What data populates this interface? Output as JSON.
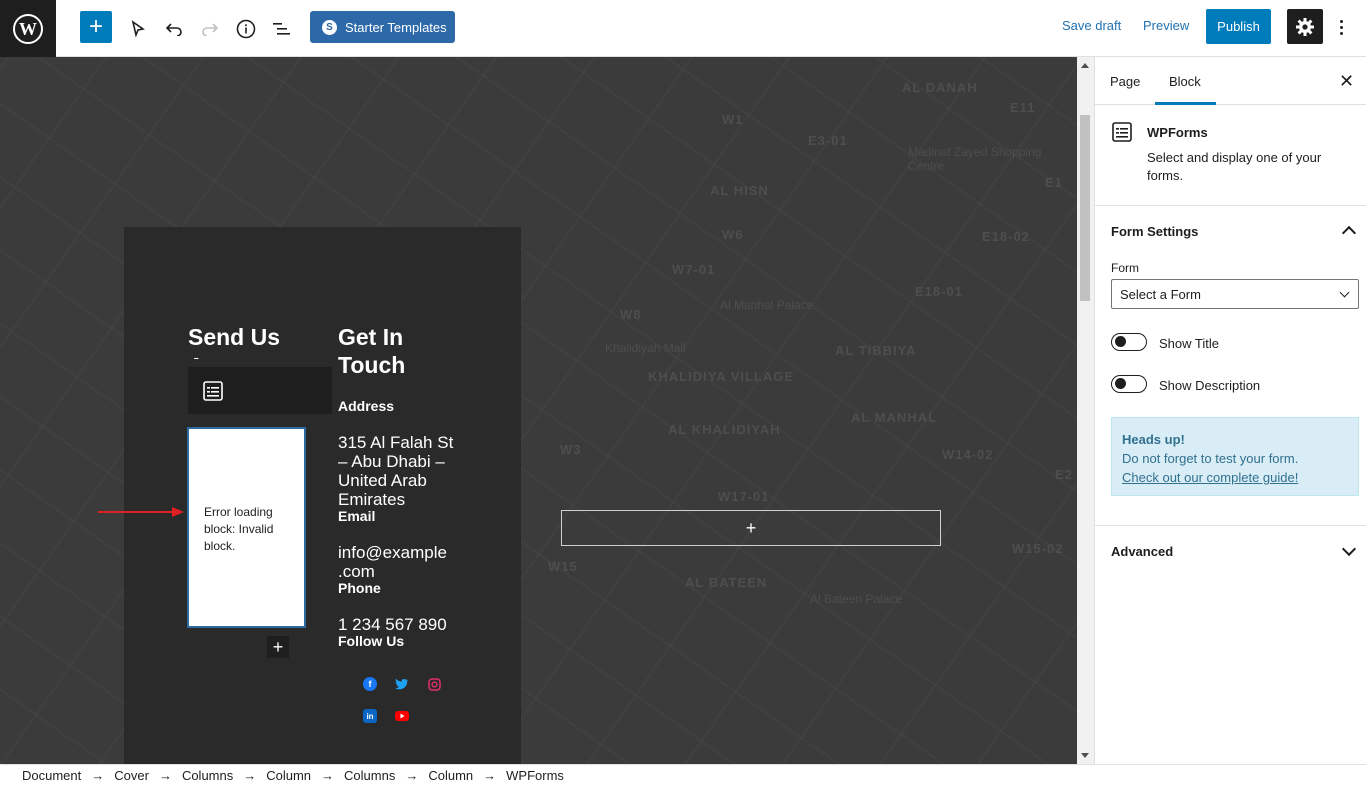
{
  "toolbar": {
    "starter_templates": "Starter Templates",
    "save_draft": "Save draft",
    "preview": "Preview",
    "publish": "Publish"
  },
  "canvas": {
    "send_us_heading": "Send Us A",
    "error_message": "Error loading block: Invalid block.",
    "get_in_touch_heading": "Get In Touch",
    "address_label": "Address",
    "address_value": "315 Al Falah St – Abu Dhabi – United Arab Emirates",
    "email_label": "Email",
    "email_value": "info@example .com",
    "phone_label": "Phone",
    "phone_value": "1 234 567 890",
    "follow_label": "Follow Us",
    "social_icons": [
      "facebook-icon",
      "twitter-icon",
      "instagram-icon",
      "linkedin-icon",
      "youtube-icon"
    ],
    "map_labels": [
      "AL DANAH",
      "AL HISN",
      "AL TIBBIYA",
      "KHALIDIYA VILLAGE",
      "AL KHALIDIYAH",
      "AL MANHAL",
      "AL BATEEN",
      "Madinat Zayed Shopping Centre",
      "Al Manhal Palace",
      "Khalidiyah Mall",
      "Al Bateen Palace",
      "W15-02",
      "W14-02",
      "W17-01",
      "W7-01",
      "E18-02",
      "E18-01",
      "E3-01",
      "W1",
      "W6",
      "W8",
      "W3",
      "E11",
      "E1",
      "E2",
      "W15"
    ]
  },
  "sidebar": {
    "tabs": [
      "Page",
      "Block"
    ],
    "active_tab": "Block",
    "block_title": "WPForms",
    "block_desc": "Select and display one of your forms.",
    "form_settings": "Form Settings",
    "form_label": "Form",
    "form_select": "Select a Form",
    "show_title": "Show Title",
    "show_description": "Show Description",
    "notice_title": "Heads up!",
    "notice_text": "Do not forget to test your form.",
    "notice_link": "Check out our complete guide!",
    "advanced": "Advanced"
  },
  "breadcrumbs": [
    "Document",
    "Cover",
    "Columns",
    "Column",
    "Columns",
    "Column",
    "WPForms"
  ],
  "colors": {
    "accent": "#007cba",
    "starter": "#2d68a9",
    "notice_bg": "#d9edf7",
    "arrow": "#e02020"
  }
}
